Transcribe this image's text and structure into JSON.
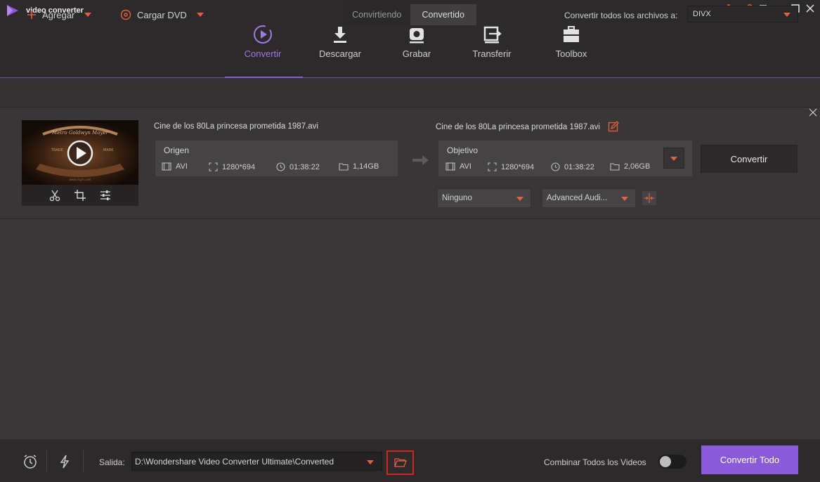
{
  "app": {
    "title": "video converter"
  },
  "window_controls": [
    "cart-icon",
    "key-icon",
    "menu-icon",
    "minimize-icon",
    "maximize-icon",
    "close-icon"
  ],
  "nav": {
    "tabs": [
      {
        "label": "Convertir",
        "icon": "convert-icon",
        "active": true
      },
      {
        "label": "Descargar",
        "icon": "download-icon",
        "active": false
      },
      {
        "label": "Grabar",
        "icon": "burn-disc-icon",
        "active": false
      },
      {
        "label": "Transferir",
        "icon": "transfer-icon",
        "active": false
      },
      {
        "label": "Toolbox",
        "icon": "toolbox-icon",
        "active": false
      }
    ]
  },
  "toolbar": {
    "add_label": "Agregar",
    "load_dvd_label": "Cargar DVD",
    "segment": {
      "converting": "Convirtiendo",
      "converted": "Convertido"
    },
    "convert_all_files_label": "Convertir todos los archivos a:",
    "format_value": "DIVX"
  },
  "file": {
    "source_name": "Cine de los 80La princesa prometida 1987.avi",
    "target_name": "Cine de los 80La princesa prometida 1987.avi",
    "thumbnail_text": {
      "line1": "Metro Goldwyn Mayer",
      "left": "TRADE",
      "right": "MARK",
      "footer": "www.mgm.com"
    },
    "source": {
      "title": "Origen",
      "format": "AVI",
      "resolution": "1280*694",
      "duration": "01:38:22",
      "size": "1,14GB"
    },
    "target": {
      "title": "Objetivo",
      "format": "AVI",
      "resolution": "1280*694",
      "duration": "01:38:22",
      "size": "2,06GB"
    },
    "convert_button": "Convertir",
    "subtitle_value": "Ninguno",
    "audio_value": "Advanced Audi..."
  },
  "bottom": {
    "output_label": "Salida:",
    "output_path": "D:\\Wondershare Video Converter Ultimate\\Converted",
    "merge_label": "Combinar Todos los Videos",
    "merge_on": false,
    "convert_all_button": "Convertir Todo"
  },
  "colors": {
    "accent": "#8a5bd8",
    "caret": "#e5603f",
    "highlight_box": "#d12424"
  }
}
